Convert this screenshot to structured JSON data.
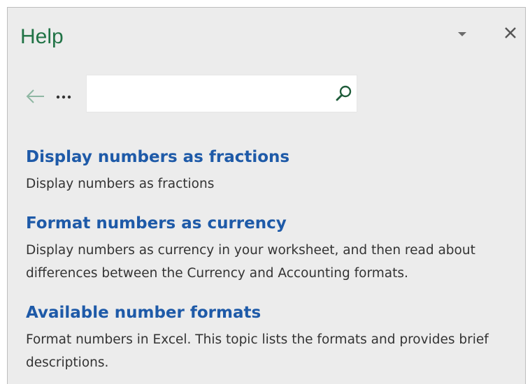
{
  "pane": {
    "title": "Help",
    "title_color": "#217346",
    "link_color": "#1e5aa8"
  },
  "icons": {
    "dropdown": "chevron-down-icon",
    "close": "close-icon",
    "back": "arrow-left-icon",
    "more": "more-icon",
    "search": "search-icon"
  },
  "search": {
    "value": "",
    "placeholder": ""
  },
  "results": [
    {
      "title": "Display numbers as fractions",
      "description": "Display numbers as fractions"
    },
    {
      "title": "Format numbers as currency",
      "description": "Display numbers as currency in your worksheet, and then read about differences between the Currency and Accounting formats."
    },
    {
      "title": "Available number formats",
      "description": "Format numbers in Excel. This topic lists the formats and provides brief descriptions."
    }
  ]
}
